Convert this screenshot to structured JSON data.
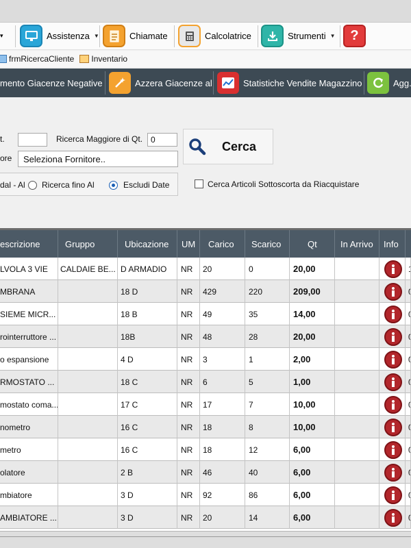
{
  "toolbar": {
    "partial_caret": "▾",
    "assistenza": "Assistenza",
    "chiamate": "Chiamate",
    "calcolatrice": "Calcolatrice",
    "strumenti": "Strumenti",
    "help_glyph": "?"
  },
  "tabs": [
    "frmRicercaCliente",
    "Inventario"
  ],
  "actions": {
    "giacenze_negative": "mento Giacenze Negative",
    "azzera": "Azzera Giacenze al",
    "statistiche": "Statistiche Vendite Magazzino",
    "agg": "Agg..."
  },
  "form": {
    "qt_label_partial": "t.",
    "qt_value": "",
    "ricerca_maggiore_label": "Ricerca Maggiore di Qt.",
    "ricerca_maggiore_value": "0",
    "fornitore_label_partial": "ore",
    "fornitore_value": "Seleziona Fornitore..",
    "radio_dal_al": "dal - Al",
    "radio_fino_al": "Ricerca fino Al",
    "radio_escludi": "Escludi Date",
    "sottoscorta_label": "Cerca Articoli Sottoscorta da Riacquistare",
    "cerca_label": "Cerca"
  },
  "grid": {
    "columns": [
      "escrizione",
      "Gruppo",
      "Ubicazione",
      "UM",
      "Carico",
      "Scarico",
      "Qt",
      "In Arrivo",
      "Info"
    ],
    "rows": [
      {
        "desc": "LVOLA 3 VIE",
        "gruppo": "CALDAIE BE...",
        "ubic": "D ARMADIO",
        "um": "NR",
        "carico": "20",
        "scarico": "0",
        "qt": "20,00",
        "extra": "1"
      },
      {
        "desc": "MBRANA",
        "gruppo": "",
        "ubic": "18 D",
        "um": "NR",
        "carico": "429",
        "scarico": "220",
        "qt": "209,00",
        "extra": "0"
      },
      {
        "desc": "SIEME MICR...",
        "gruppo": "",
        "ubic": "18 B",
        "um": "NR",
        "carico": "49",
        "scarico": "35",
        "qt": "14,00",
        "extra": "0"
      },
      {
        "desc": "rointerruttore ...",
        "gruppo": "",
        "ubic": "18B",
        "um": "NR",
        "carico": "48",
        "scarico": "28",
        "qt": "20,00",
        "extra": "0"
      },
      {
        "desc": "o espansione",
        "gruppo": "",
        "ubic": "4 D",
        "um": "NR",
        "carico": "3",
        "scarico": "1",
        "qt": "2,00",
        "extra": "0"
      },
      {
        "desc": "RMOSTATO ...",
        "gruppo": "",
        "ubic": "18 C",
        "um": "NR",
        "carico": "6",
        "scarico": "5",
        "qt": "1,00",
        "extra": "0"
      },
      {
        "desc": "mostato coma...",
        "gruppo": "",
        "ubic": "17 C",
        "um": "NR",
        "carico": "17",
        "scarico": "7",
        "qt": "10,00",
        "extra": "0"
      },
      {
        "desc": "nometro",
        "gruppo": "",
        "ubic": "16 C",
        "um": "NR",
        "carico": "18",
        "scarico": "8",
        "qt": "10,00",
        "extra": "0"
      },
      {
        "desc": "metro",
        "gruppo": "",
        "ubic": "16 C",
        "um": "NR",
        "carico": "18",
        "scarico": "12",
        "qt": "6,00",
        "extra": "0"
      },
      {
        "desc": "olatore",
        "gruppo": "",
        "ubic": "2 B",
        "um": "NR",
        "carico": "46",
        "scarico": "40",
        "qt": "6,00",
        "extra": "0"
      },
      {
        "desc": "mbiatore",
        "gruppo": "",
        "ubic": "3 D",
        "um": "NR",
        "carico": "92",
        "scarico": "86",
        "qt": "6,00",
        "extra": "0"
      },
      {
        "desc": "AMBIATORE ...",
        "gruppo": "",
        "ubic": "3 D",
        "um": "NR",
        "carico": "20",
        "scarico": "14",
        "qt": "6,00",
        "extra": "0"
      }
    ]
  },
  "colors": {
    "header_bg": "#4c5a66",
    "toolbar_dark": "#3d4a54",
    "info_red": "#b2262b"
  }
}
